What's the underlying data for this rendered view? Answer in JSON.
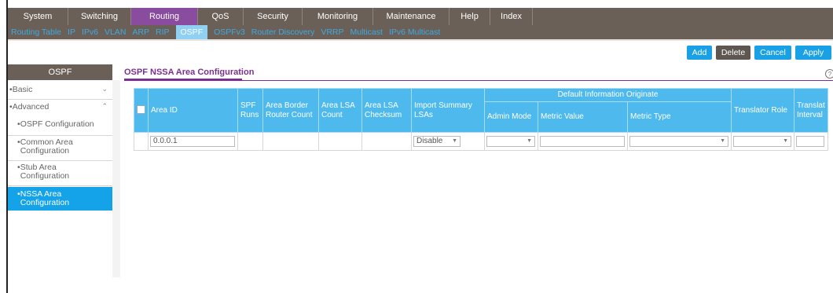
{
  "top_nav": {
    "tabs": [
      {
        "label": "System",
        "active": false
      },
      {
        "label": "Switching",
        "active": false
      },
      {
        "label": "Routing",
        "active": true
      },
      {
        "label": "QoS",
        "active": false
      },
      {
        "label": "Security",
        "active": false
      },
      {
        "label": "Monitoring",
        "active": false
      },
      {
        "label": "Maintenance",
        "active": false
      },
      {
        "label": "Help",
        "active": false
      },
      {
        "label": "Index",
        "active": false
      }
    ]
  },
  "sub_nav": {
    "items": [
      {
        "label": "Routing Table",
        "active": false
      },
      {
        "label": "IP",
        "active": false
      },
      {
        "label": "IPv6",
        "active": false
      },
      {
        "label": "VLAN",
        "active": false
      },
      {
        "label": "ARP",
        "active": false
      },
      {
        "label": "RIP",
        "active": false
      },
      {
        "label": "OSPF",
        "active": true
      },
      {
        "label": "OSPFv3",
        "active": false
      },
      {
        "label": "Router Discovery",
        "active": false
      },
      {
        "label": "VRRP",
        "active": false
      },
      {
        "label": "Multicast",
        "active": false
      },
      {
        "label": "IPv6 Multicast",
        "active": false
      }
    ]
  },
  "actions": {
    "add": "Add",
    "delete": "Delete",
    "cancel": "Cancel",
    "apply": "Apply"
  },
  "sidebar": {
    "title": "OSPF",
    "items": [
      {
        "label": "Basic",
        "bullet": "•",
        "expander": "⌄"
      },
      {
        "label": "Advanced",
        "bullet": "•",
        "expander": "⌃"
      },
      {
        "label": "OSPF Configuration",
        "bullet": "•"
      },
      {
        "label": "Common Area Configuration",
        "bullet": "•"
      },
      {
        "label": "Stub Area Configuration",
        "bullet": "•"
      },
      {
        "label": "NSSA Area Configuration",
        "bullet": "•",
        "active": true
      }
    ]
  },
  "content": {
    "title": "OSPF NSSA Area Configuration",
    "help_icon": "help-icon",
    "table": {
      "group_header": "Default Information Originate",
      "headers": {
        "area_id": "Area ID",
        "spf_runs": "SPF Runs",
        "abr_count": "Area Border Router Count",
        "lsa_count": "Area LSA Count",
        "lsa_checksum": "Area LSA Checksum",
        "import_summary": "Import Summary LSAs",
        "admin_mode": "Admin Mode",
        "metric_value": "Metric Value",
        "metric_type": "Metric Type",
        "translator_role": "Translator Role",
        "translator_interval": "Translat Interval"
      },
      "input_row": {
        "area_id": "0.0.0.1",
        "import_summary": "Disable",
        "admin_mode": "",
        "metric_value": "",
        "metric_type": "",
        "translator_role": "",
        "translator_interval": ""
      }
    }
  }
}
